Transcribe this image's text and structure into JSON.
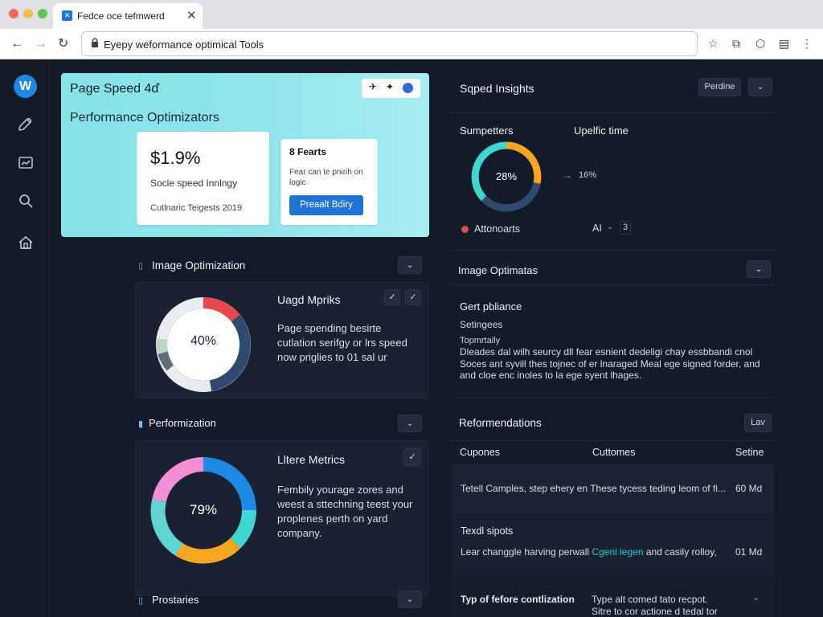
{
  "browser": {
    "tab_title": "Fedce oce tefmwerd",
    "address": "Eyepy weformance optimical Tools"
  },
  "hero": {
    "title": "Page Speed 4ď",
    "subtitle": "Performance Optimizators",
    "stat_value": "$1.9%",
    "stat_label": "Socle speed Innlngy",
    "stat_footer": "Cutlnaric Teigests 2019",
    "feature_title": "8 Fearts",
    "feature_text": "Fear can te pnirih on logic",
    "feature_button": "Preaalt Bdiry"
  },
  "speed_insights": {
    "title": "Sqped Insights",
    "button": "Perdine",
    "col1": "Sumpetters",
    "col2": "Upelfic time",
    "donut_value": "28%",
    "arrow_value": "16%",
    "status_label": "Attonoarts",
    "select_value": "AI",
    "select_extra": "3"
  },
  "image_opt": {
    "title": "Image Optimization",
    "panel_title": "Uagd Mpriks",
    "donut_value": "40%",
    "text": "Page spending besirte cutlation serifgy or lrs speed now priglies to 01 sal ur"
  },
  "image_opt_right": {
    "title": "Image Optimatas",
    "sub": "Gert pbliance",
    "line1": "Setingees",
    "line2": "Topmrtaily",
    "body": "Dleades dal wilh seurcy dll fear esnient dedeligi chay essbbandi cnol Soces ant syvill thes tojnec of er lnaraged Meal ege signed forder, and and cloe enc inoles to la ege syent lhages."
  },
  "perf": {
    "title": "Performization",
    "panel_title": "Lltere Metrics",
    "donut_value": "79%",
    "text": "Fembily yourage zores and weest a sttechning teest your proplenes perth on yard company."
  },
  "recommend": {
    "title": "Reformendations",
    "button": "Lav",
    "columns": [
      "Cupones",
      "Cuttomes",
      "Setine"
    ],
    "rows": [
      {
        "text": "Tetell Camples, step ehery en These tycess teding leom of fi...",
        "value": "60 Md"
      },
      {
        "head": "Texdl sipots",
        "text_before": "Lear changgle harving perwall",
        "link": "Cgenl legen",
        "text_after": "and casily rolloy,",
        "value": "01 Md"
      }
    ],
    "foot_left": "Typ of fefore contlization",
    "foot_right_1": "Type alt comed tato recpot.",
    "foot_right_2": "Sitre to cor actione d tedal tor"
  },
  "prostaries": {
    "title": "Prostaries"
  },
  "colors": {
    "accent": "#1e88e5",
    "hero_bg": "#7fe0e6",
    "teal": "#3dd6d0",
    "orange": "#f5a623",
    "red": "#e5484d",
    "navy": "#2f4a6e"
  }
}
